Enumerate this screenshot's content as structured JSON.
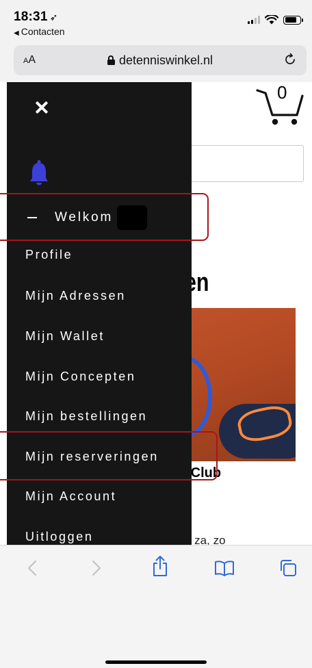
{
  "status_bar": {
    "time": "18:31",
    "back_app": "Contacten"
  },
  "address_bar": {
    "aa_label": "AA",
    "url": "detenniswinkel.nl"
  },
  "cart": {
    "count": "0"
  },
  "page": {
    "heading_fragment": "en",
    "club_fragment": "s Club",
    "days_fragment": "r, za, zo"
  },
  "drawer": {
    "welcome_label": "Welkom",
    "items": [
      {
        "label": "Profile"
      },
      {
        "label": "Mijn Adressen"
      },
      {
        "label": "Mijn Wallet"
      },
      {
        "label": "Mijn Concepten"
      },
      {
        "label": "Mijn bestellingen"
      },
      {
        "label": "Mijn reserveringen"
      },
      {
        "label": "Mijn Account"
      },
      {
        "label": "Uitloggen"
      }
    ]
  },
  "colors": {
    "drawer_bg": "#161616",
    "bell": "#3d3fd9",
    "highlight": "#a8141b",
    "toolbar_icon": "#2f6ad8"
  },
  "icons": {
    "close": "close-icon",
    "bell": "bell-icon",
    "cart": "cart-icon",
    "share": "share-icon",
    "bookmarks": "book-icon",
    "tabs": "tabs-icon"
  }
}
